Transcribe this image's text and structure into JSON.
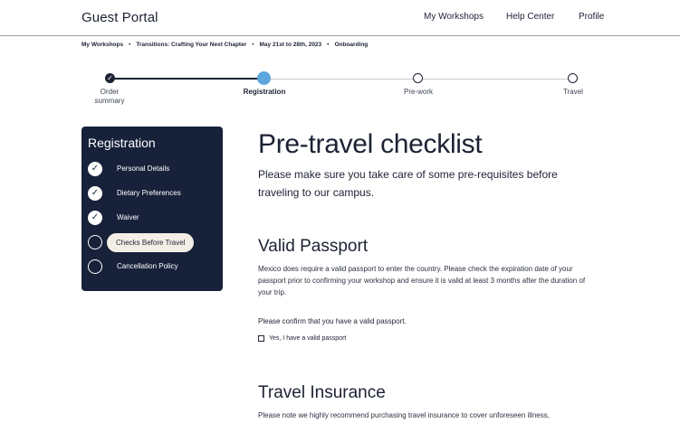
{
  "header": {
    "brand": "Guest Portal",
    "nav": [
      "My Workshops",
      "Help Center",
      "Profile"
    ]
  },
  "breadcrumb": [
    "My Workshops",
    "Transitions: Crafting Your Next Chapter",
    "May 21st to 28th, 2023",
    "Onboarding"
  ],
  "breadcrumb_separator": "•",
  "stepper": {
    "steps": [
      {
        "label": "Order summary",
        "state": "done"
      },
      {
        "label": "Registration",
        "state": "active"
      },
      {
        "label": "Pre-work",
        "state": "todo"
      },
      {
        "label": "Travel",
        "state": "todo"
      }
    ]
  },
  "sidebar": {
    "title": "Registration",
    "items": [
      {
        "label": "Personal Details",
        "state": "done"
      },
      {
        "label": "Dietary Preferences",
        "state": "done"
      },
      {
        "label": "Waiver",
        "state": "done"
      },
      {
        "label": "Checks Before Travel",
        "state": "current"
      },
      {
        "label": "Cancellation Policy",
        "state": "todo"
      }
    ]
  },
  "content": {
    "title": "Pre-travel checklist",
    "lead": "Please make sure you take care of some pre-requisites before traveling to our campus.",
    "passport": {
      "heading": "Valid Passport",
      "body": "Mexico does require a valid passport to enter the country. Please check the expiration date of your passport prior to confirming your workshop and ensure it is valid at least 3 months after the duration of your trip.",
      "confirm_prompt": "Please confirm that you have a valid passport.",
      "checkbox_label": "Yes, I have a valid passport",
      "checked": false
    },
    "insurance": {
      "heading": "Travel Insurance",
      "body": "Please note we highly recommend purchasing travel insurance to cover unforeseen illness,"
    }
  },
  "colors": {
    "navy": "#17223a",
    "accent": "#5aa6dd",
    "pill": "#f4efe6"
  },
  "icons": {
    "done": "check-icon",
    "todo": "empty-circle-icon"
  }
}
